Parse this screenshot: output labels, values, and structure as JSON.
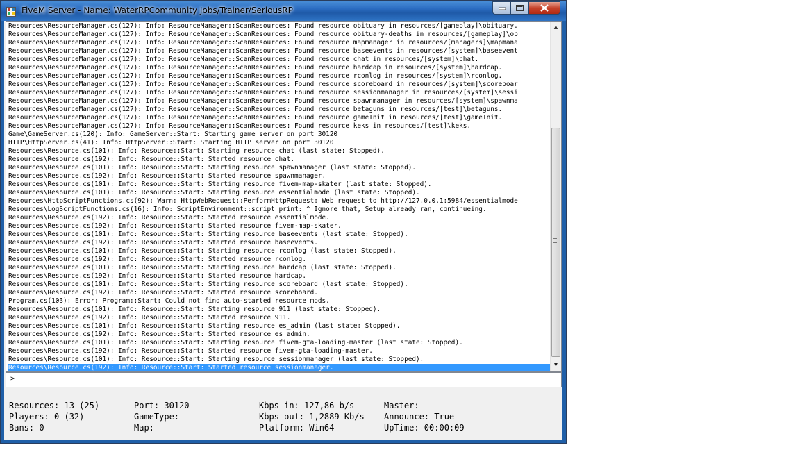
{
  "window": {
    "title": "FiveM Server - Name: WaterRPCommunity Jobs/Trainer/SeriousRP",
    "controls": {
      "minimize": "—",
      "maximize": "□",
      "close": "✕"
    }
  },
  "log": {
    "lines": [
      "Resources\\ResourceManager.cs(127): Info: ResourceManager::ScanResources: Found resource obituary in resources/[gameplay]\\obituary.",
      "Resources\\ResourceManager.cs(127): Info: ResourceManager::ScanResources: Found resource obituary-deaths in resources/[gameplay]\\ob",
      "Resources\\ResourceManager.cs(127): Info: ResourceManager::ScanResources: Found resource mapmanager in resources/[managers]\\mapmana",
      "Resources\\ResourceManager.cs(127): Info: ResourceManager::ScanResources: Found resource baseevents in resources/[system]\\baseevent",
      "Resources\\ResourceManager.cs(127): Info: ResourceManager::ScanResources: Found resource chat in resources/[system]\\chat.",
      "Resources\\ResourceManager.cs(127): Info: ResourceManager::ScanResources: Found resource hardcap in resources/[system]\\hardcap.",
      "Resources\\ResourceManager.cs(127): Info: ResourceManager::ScanResources: Found resource rconlog in resources/[system]\\rconlog.",
      "Resources\\ResourceManager.cs(127): Info: ResourceManager::ScanResources: Found resource scoreboard in resources/[system]\\scoreboar",
      "Resources\\ResourceManager.cs(127): Info: ResourceManager::ScanResources: Found resource sessionmanager in resources/[system]\\sessi",
      "Resources\\ResourceManager.cs(127): Info: ResourceManager::ScanResources: Found resource spawnmanager in resources/[system]\\spawnma",
      "Resources\\ResourceManager.cs(127): Info: ResourceManager::ScanResources: Found resource betaguns in resources/[test]\\betaguns.",
      "Resources\\ResourceManager.cs(127): Info: ResourceManager::ScanResources: Found resource gameInit in resources/[test]\\gameInit.",
      "Resources\\ResourceManager.cs(127): Info: ResourceManager::ScanResources: Found resource keks in resources/[test]\\keks.",
      "Game\\GameServer.cs(120): Info: GameServer::Start: Starting game server on port 30120",
      "HTTP\\HttpServer.cs(41): Info: HttpServer::Start: Starting HTTP server on port 30120",
      "Resources\\Resource.cs(101): Info: Resource::Start: Starting resource chat (last state: Stopped).",
      "Resources\\Resource.cs(192): Info: Resource::Start: Started resource chat.",
      "Resources\\Resource.cs(101): Info: Resource::Start: Starting resource spawnmanager (last state: Stopped).",
      "Resources\\Resource.cs(192): Info: Resource::Start: Started resource spawnmanager.",
      "Resources\\Resource.cs(101): Info: Resource::Start: Starting resource fivem-map-skater (last state: Stopped).",
      "Resources\\Resource.cs(101): Info: Resource::Start: Starting resource essentialmode (last state: Stopped).",
      "Resources\\HttpScriptFunctions.cs(92): Warn: HttpWebRequest::PerformHttpRequest: Web request to http://127.0.0.1:5984/essentialmode",
      "Resources\\LogScriptFunctions.cs(16): Info: ScriptEnvironment::script print: ^ Ignore that, Setup already ran, continueing.",
      "Resources\\Resource.cs(192): Info: Resource::Start: Started resource essentialmode.",
      "Resources\\Resource.cs(192): Info: Resource::Start: Started resource fivem-map-skater.",
      "Resources\\Resource.cs(101): Info: Resource::Start: Starting resource baseevents (last state: Stopped).",
      "Resources\\Resource.cs(192): Info: Resource::Start: Started resource baseevents.",
      "Resources\\Resource.cs(101): Info: Resource::Start: Starting resource rconlog (last state: Stopped).",
      "Resources\\Resource.cs(192): Info: Resource::Start: Started resource rconlog.",
      "Resources\\Resource.cs(101): Info: Resource::Start: Starting resource hardcap (last state: Stopped).",
      "Resources\\Resource.cs(192): Info: Resource::Start: Started resource hardcap.",
      "Resources\\Resource.cs(101): Info: Resource::Start: Starting resource scoreboard (last state: Stopped).",
      "Resources\\Resource.cs(192): Info: Resource::Start: Started resource scoreboard.",
      "Program.cs(103): Error: Program::Start: Could not find auto-started resource mods.",
      "Resources\\Resource.cs(101): Info: Resource::Start: Starting resource 911 (last state: Stopped).",
      "Resources\\Resource.cs(192): Info: Resource::Start: Started resource 911.",
      "Resources\\Resource.cs(101): Info: Resource::Start: Starting resource es_admin (last state: Stopped).",
      "Resources\\Resource.cs(192): Info: Resource::Start: Started resource es_admin.",
      "Resources\\Resource.cs(101): Info: Resource::Start: Starting resource fivem-gta-loading-master (last state: Stopped).",
      "Resources\\Resource.cs(192): Info: Resource::Start: Started resource fivem-gta-loading-master.",
      "Resources\\Resource.cs(101): Info: Resource::Start: Starting resource sessionmanager (last state: Stopped).",
      "Resources\\Resource.cs(192): Info: Resource::Start: Started resource sessionmanager."
    ],
    "selected_index": 41,
    "scroll_arrows": {
      "up": "▲",
      "down": "▼"
    }
  },
  "command": {
    "prompt": ">"
  },
  "stats": {
    "resources": "Resources: 13 (25)",
    "players": "Players: 0 (32)",
    "bans": "Bans: 0",
    "port": "Port: 30120",
    "gametype": "GameType:",
    "map": "Map:",
    "kbps_in": "Kbps in: 127,86 b/s",
    "kbps_out": "Kbps out: 1,2889 Kb/s",
    "platform": "Platform: Win64",
    "master": "Master:",
    "announce": "Announce: True",
    "uptime": "UpTime: 00:00:09"
  }
}
